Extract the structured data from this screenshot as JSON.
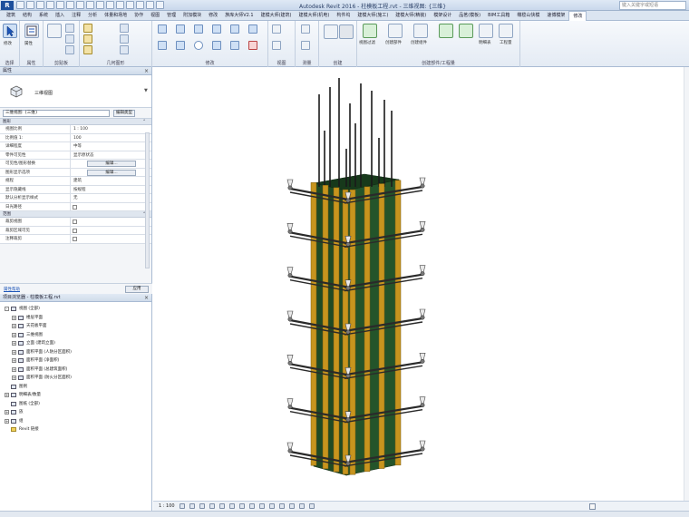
{
  "app": {
    "logo": "R",
    "title": "Autodesk Revit 2016 -  柱模板工程.rvt - 三维视图: {三维}",
    "search_placeholder": "键入关键字或短语"
  },
  "ribbon": {
    "tabs": [
      "建筑",
      "结构",
      "系统",
      "插入",
      "注释",
      "分析",
      "体量和场地",
      "协作",
      "视图",
      "管理",
      "附加模块",
      "修改",
      "族库大师V2.1",
      "建模大师(建筑)",
      "建模大师(机电)",
      "构件坞",
      "建模大师(施工)",
      "建模大师(精装)",
      "模架设计",
      "品茗(模板)",
      "BIM工具箱",
      "橄榄山快模",
      "速博模架",
      "修改"
    ],
    "active_tab_index": 23,
    "groups": [
      {
        "label": "选择"
      },
      {
        "label": "属性"
      },
      {
        "label": "剪贴板"
      },
      {
        "label": "几何图形"
      },
      {
        "label": "修改"
      },
      {
        "label": "视图"
      },
      {
        "label": "测量"
      },
      {
        "label": "创建"
      },
      {
        "label": "创建部件/工程量"
      }
    ],
    "buttons": {
      "modify": "修改",
      "properties": "属性",
      "view_filter": "视图过滤",
      "create_parts": "创建部件",
      "create_assembly": "创建组件",
      "schedules": "明细表",
      "takeoff": "工程量"
    }
  },
  "properties": {
    "title": "属性",
    "type_name": "三维视图",
    "filter_value": "三维视图: {三维}",
    "edit_type": "编辑类型",
    "sections": {
      "graphics": "图形",
      "range": "范围"
    },
    "rows": [
      {
        "name": "视图比例",
        "value": "1 : 100"
      },
      {
        "name": "比例值 1:",
        "value": "100"
      },
      {
        "name": "详细程度",
        "value": "中等"
      },
      {
        "name": "零件可见性",
        "value": "显示原状态"
      },
      {
        "name": "可见性/图形替换",
        "value": "编辑..."
      },
      {
        "name": "图形显示选项",
        "value": "编辑..."
      },
      {
        "name": "规程",
        "value": "建筑"
      },
      {
        "name": "显示隐藏线",
        "value": "按规程"
      },
      {
        "name": "默认分析显示样式",
        "value": "无"
      },
      {
        "name": "日光路径",
        "value": ""
      }
    ],
    "range_rows": [
      {
        "name": "裁剪视图",
        "value": ""
      },
      {
        "name": "裁剪区域可见",
        "value": ""
      },
      {
        "name": "注释裁剪",
        "value": ""
      }
    ],
    "help_link": "属性帮助",
    "apply": "应用"
  },
  "browser": {
    "title": "项目浏览器 - 柱模板工程.rvt",
    "nodes": [
      {
        "label": "视图 (全部)",
        "level": 0,
        "toggle": "-"
      },
      {
        "label": "楼层平面",
        "level": 1,
        "toggle": "+"
      },
      {
        "label": "天花板平面",
        "level": 1,
        "toggle": "+"
      },
      {
        "label": "三维视图",
        "level": 1,
        "toggle": "+"
      },
      {
        "label": "立面 (建筑立面)",
        "level": 1,
        "toggle": "+"
      },
      {
        "label": "面积平面 (人防分区面积)",
        "level": 1,
        "toggle": "+"
      },
      {
        "label": "面积平面 (净面积)",
        "level": 1,
        "toggle": "+"
      },
      {
        "label": "面积平面 (总建筑面积)",
        "level": 1,
        "toggle": "+"
      },
      {
        "label": "面积平面 (防火分区面积)",
        "level": 1,
        "toggle": "+"
      },
      {
        "label": "图例",
        "level": 0,
        "toggle": ""
      },
      {
        "label": "明细表/数量",
        "level": 0,
        "toggle": "+"
      },
      {
        "label": "图纸 (全部)",
        "level": 0,
        "toggle": ""
      },
      {
        "label": "族",
        "level": 0,
        "toggle": "+"
      },
      {
        "label": "组",
        "level": 0,
        "toggle": "+"
      },
      {
        "label": "Revit 链接",
        "level": 0,
        "toggle": ""
      }
    ]
  },
  "viewbar": {
    "scale": "1 : 100"
  },
  "colors": {
    "formwork_panel": "#1f4a24",
    "timber_studs": "#c7941e",
    "steel_clamps": "#2a2a2a",
    "rebar": "#1a1a1a"
  }
}
